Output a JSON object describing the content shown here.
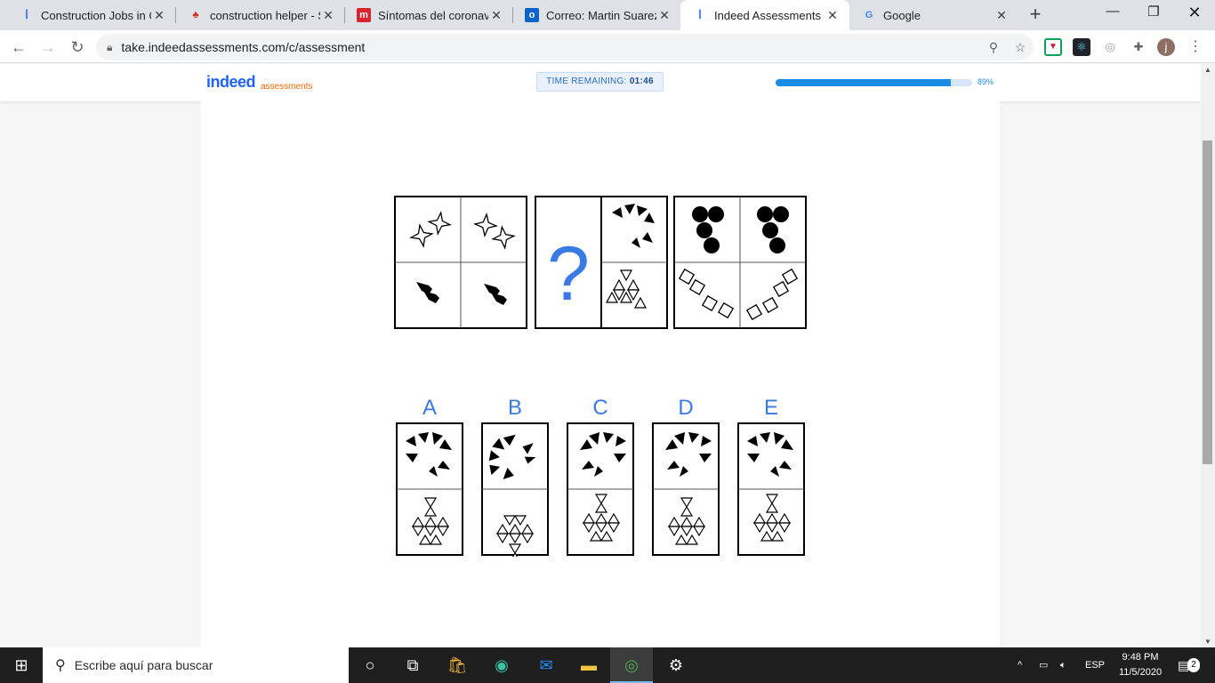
{
  "browser": {
    "tabs": [
      {
        "title": "Construction Jobs in Ca",
        "icon": "indeed-icon"
      },
      {
        "title": "construction helper - Su",
        "icon": "maple-leaf-icon"
      },
      {
        "title": "Síntomas del coronavir",
        "icon": "m-icon"
      },
      {
        "title": "Correo: Martin Suarez -",
        "icon": "outlook-icon"
      },
      {
        "title": "Indeed Assessments",
        "icon": "indeed-icon",
        "active": true
      },
      {
        "title": "Google",
        "icon": "google-icon"
      }
    ],
    "url": "take.indeedassessments.com/c/assessment",
    "profile_initial": "j"
  },
  "header": {
    "logo_main": "indeed",
    "logo_sub": "assessments",
    "timer_label": "TIME REMAINING:",
    "timer_value": "01:46",
    "progress_percent": 89,
    "progress_label": "89%"
  },
  "question": {
    "placeholder": "?",
    "options": [
      "A",
      "B",
      "C",
      "D",
      "E"
    ]
  },
  "taskbar": {
    "search_placeholder": "Escribe aquí para buscar",
    "language": "ESP",
    "time": "9:48 PM",
    "date": "11/5/2020",
    "notification_count": "2"
  },
  "colors": {
    "accent": "#3a7ae4",
    "progress": "#1a8ce3",
    "brand_blue": "#2164f3",
    "brand_orange": "#ff6600"
  }
}
